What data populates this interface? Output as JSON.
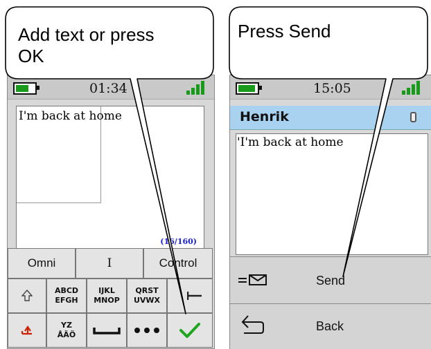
{
  "left_phone": {
    "status": {
      "time": "01:34"
    },
    "message": {
      "text": "I'm back at home",
      "counter": "(16/160)"
    },
    "mode_row": [
      "Omni",
      "I",
      "Control"
    ],
    "letter_keys": [
      {
        "top": "ABCD",
        "bottom": "EFGH"
      },
      {
        "top": "IJKL",
        "bottom": "MNOP"
      },
      {
        "top": "QRST",
        "bottom": "UVWX"
      },
      {
        "top": "YZ",
        "bottom": "ÅÄÖ"
      }
    ]
  },
  "right_phone": {
    "status": {
      "time": "15:05"
    },
    "contact": {
      "name": "Henrik"
    },
    "message": {
      "text": "'I'm back at home"
    },
    "actions": {
      "send_label": "Send",
      "back_label": "Back"
    }
  },
  "bubbles": {
    "left": {
      "line1": "Add text or press",
      "line2": "OK"
    },
    "right": {
      "line1": "Press Send"
    }
  },
  "icons": [
    "battery-icon",
    "signal-icon",
    "shift-up-icon",
    "backspace-icon",
    "delete-icon",
    "space-icon",
    "more-dots-icon",
    "ok-check-icon",
    "envelope-icon",
    "back-arrow-icon",
    "phone-icon"
  ],
  "colors": {
    "accent_green": "#1a9a1a",
    "name_bar": "#a9d2f0",
    "counter_blue": "#1a22cc",
    "delete_red": "#cc2200"
  }
}
